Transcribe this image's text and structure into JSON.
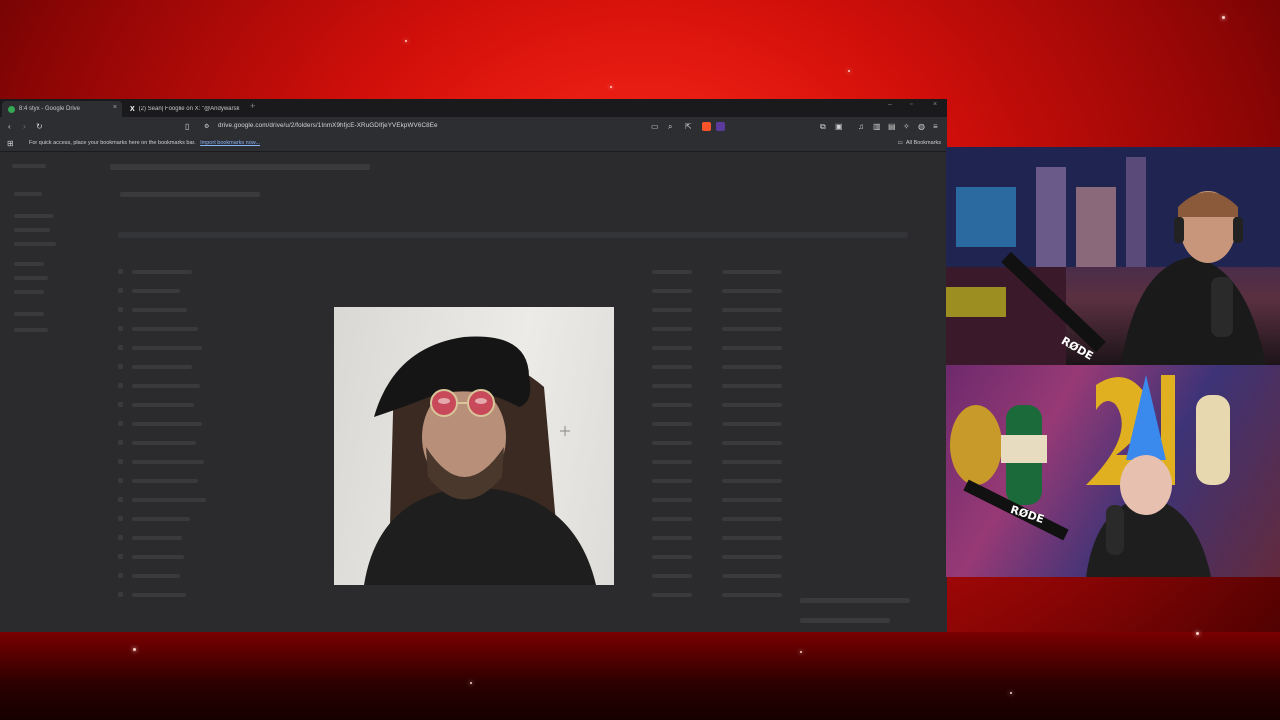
{
  "browser": {
    "tabs": [
      {
        "label": "8:4 styx - Google Drive",
        "active": true,
        "favicon_color": "#34a853"
      },
      {
        "label": "(2) Sean| Fooglie on X: \"@Andywarsk",
        "active": false,
        "favicon_color": "#ffffff"
      }
    ],
    "new_tab_glyph": "+",
    "close_glyph": "×",
    "window_controls": [
      "–",
      "▫",
      "×"
    ],
    "address_bar": {
      "url": "drive.google.com/drive/u/2/folders/1InmX9hfjcE-XRuGDIfjeYVEkpWV6C8Ee"
    },
    "bookmarks_bar": {
      "prompt": "For quick access, place your bookmarks here on the bookmarks bar.",
      "import_link": "Import bookmarks now...",
      "all_bookmarks": "All Bookmarks"
    },
    "icons": {
      "back": "arrow-left-icon",
      "forward": "arrow-right-icon",
      "reload": "reload-icon",
      "bookmark": "bookmark-icon",
      "apps": "apps-grid-icon"
    }
  },
  "stream": {
    "cam_top_mic_brand": "RØDE",
    "cam_bottom_mic_brand": "RØDE"
  },
  "colors": {
    "background_red": "#d10f0a",
    "browser_dark": "#202124",
    "link_blue": "#8ab4f8"
  }
}
